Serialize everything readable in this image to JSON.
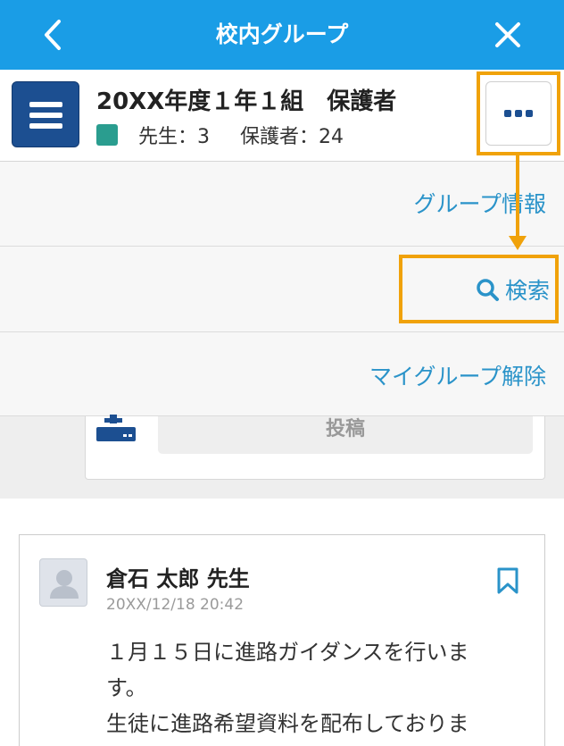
{
  "navbar": {
    "title": "校内グループ",
    "back_icon": "chevron-left-icon",
    "close_icon": "close-icon"
  },
  "group": {
    "title": "20XX年度１年１組　保護者",
    "teachers_label": "先生：3",
    "guardians_label": "保護者：24",
    "menu_icon": "hamburger-icon",
    "more_icon": "more-dots-icon"
  },
  "menu": {
    "items": [
      {
        "label": "グループ情報"
      },
      {
        "label": "検索",
        "icon": "search-icon"
      },
      {
        "label": "マイグループ解除"
      }
    ]
  },
  "composer": {
    "post_label": "投稿",
    "icon": "post-upload-icon"
  },
  "post": {
    "author": "倉石 太郎 先生",
    "timestamp": "20XX/12/18 20:42",
    "body_lines": [
      "１月１５日に進路ガイダンスを行いま",
      "す。",
      "生徒に進路希望資料を配布しておりま"
    ],
    "bookmark_icon": "bookmark-icon"
  },
  "colors": {
    "navbar": "#1a9de6",
    "menu_button": "#1c4f91",
    "link": "#2a93c9",
    "highlight": "#f0a20a",
    "tag": "#2a9d8f"
  }
}
